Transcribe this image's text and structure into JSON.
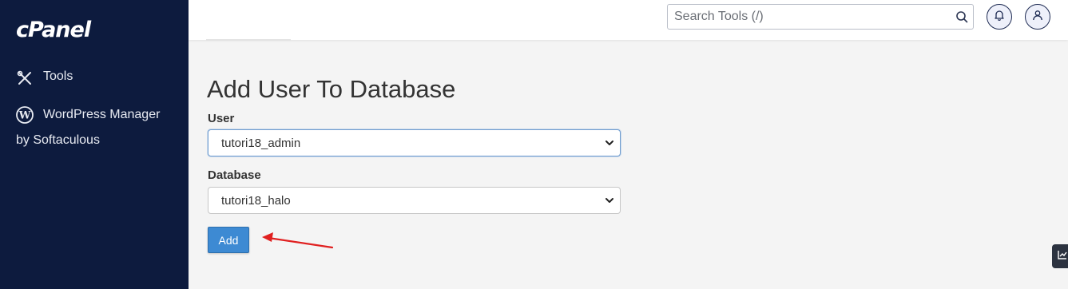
{
  "sidebar": {
    "logo": "cPanel",
    "items": [
      {
        "label": "Tools",
        "icon": "tools-icon"
      },
      {
        "label": "WordPress Manager",
        "label_line2": "by Softaculous",
        "icon": "wordpress-icon"
      }
    ]
  },
  "topbar": {
    "search_placeholder": "Search Tools (/)",
    "search_icon": "search-icon",
    "bell_icon": "bell-icon",
    "user_icon": "user-icon"
  },
  "main": {
    "title": "Add User To Database",
    "user_label": "User",
    "user_value": "tutori18_admin",
    "database_label": "Database",
    "database_value": "tutori18_halo",
    "add_label": "Add"
  },
  "colors": {
    "sidebar_bg": "#0d1b3e",
    "button_bg": "#3d8ad3",
    "arrow": "#e02020"
  }
}
